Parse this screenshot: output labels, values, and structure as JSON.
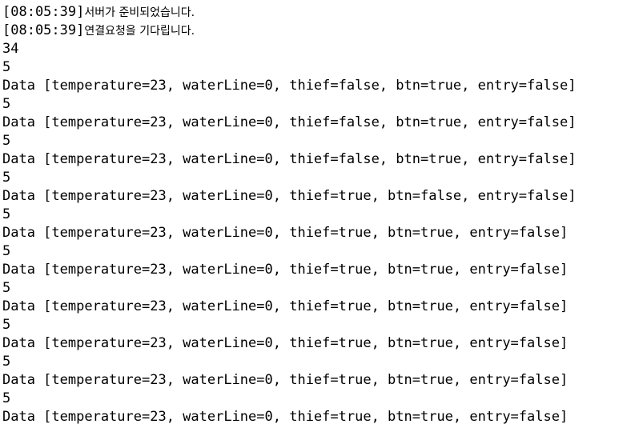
{
  "console": {
    "header_lines": [
      {
        "timestamp": "[08:05:39]",
        "message": "서버가 준비되었습니다."
      },
      {
        "timestamp": "[08:05:39]",
        "message": "연결요청을 기다립니다."
      }
    ],
    "lines": [
      "34",
      "5",
      "Data [temperature=23, waterLine=0, thief=false, btn=true, entry=false]",
      "5",
      "Data [temperature=23, waterLine=0, thief=false, btn=true, entry=false]",
      "5",
      "Data [temperature=23, waterLine=0, thief=false, btn=true, entry=false]",
      "5",
      "Data [temperature=23, waterLine=0, thief=true, btn=false, entry=false]",
      "5",
      "Data [temperature=23, waterLine=0, thief=true, btn=true, entry=false]",
      "5",
      "Data [temperature=23, waterLine=0, thief=true, btn=true, entry=false]",
      "5",
      "Data [temperature=23, waterLine=0, thief=true, btn=true, entry=false]",
      "5",
      "Data [temperature=23, waterLine=0, thief=true, btn=true, entry=false]",
      "5",
      "Data [temperature=23, waterLine=0, thief=true, btn=true, entry=false]",
      "5",
      "Data [temperature=23, waterLine=0, thief=true, btn=true, entry=false]"
    ]
  }
}
